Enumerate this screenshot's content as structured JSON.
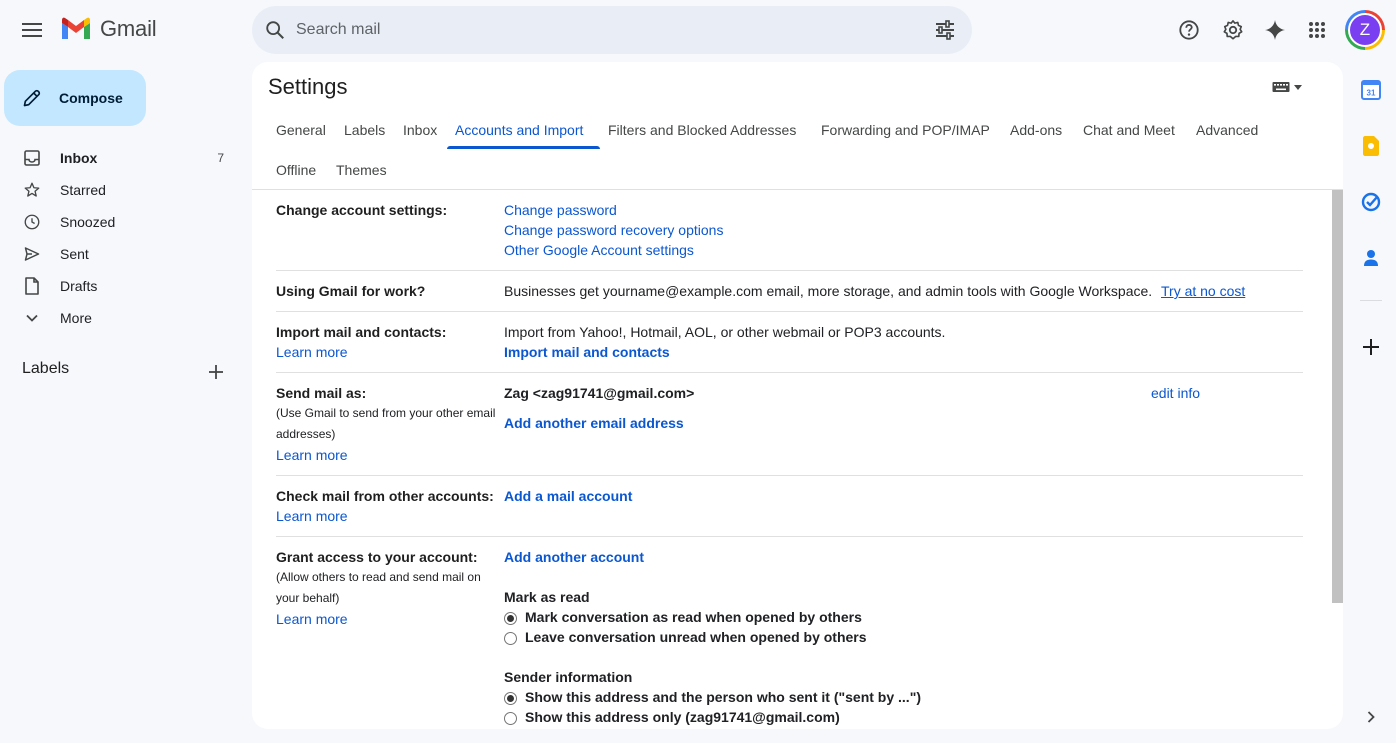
{
  "app": {
    "name": "Gmail"
  },
  "search": {
    "placeholder": "Search mail"
  },
  "user": {
    "initial": "Z"
  },
  "compose": {
    "label": "Compose"
  },
  "nav": {
    "items": [
      {
        "label": "Inbox",
        "count": "7",
        "icon": "inbox-icon"
      },
      {
        "label": "Starred",
        "count": "",
        "icon": "star-icon"
      },
      {
        "label": "Snoozed",
        "count": "",
        "icon": "clock-icon"
      },
      {
        "label": "Sent",
        "count": "",
        "icon": "send-icon"
      },
      {
        "label": "Drafts",
        "count": "",
        "icon": "draft-icon"
      },
      {
        "label": "More",
        "count": "",
        "icon": "chevron-down-icon"
      }
    ],
    "labels_heading": "Labels"
  },
  "settings": {
    "title": "Settings",
    "tabs": [
      "General",
      "Labels",
      "Inbox",
      "Accounts and Import",
      "Filters and Blocked Addresses",
      "Forwarding and POP/IMAP",
      "Add-ons",
      "Chat and Meet",
      "Advanced",
      "Offline",
      "Themes"
    ],
    "active_tab": "Accounts and Import",
    "change_account": {
      "label": "Change account settings:",
      "links": [
        "Change password",
        "Change password recovery options",
        "Other Google Account settings"
      ]
    },
    "gmail_work": {
      "label": "Using Gmail for work?",
      "text": "Businesses get yourname@example.com email, more storage, and admin tools with Google Workspace.",
      "link": "Try at no cost"
    },
    "import_mail": {
      "label": "Import mail and contacts:",
      "learn_more": "Learn more",
      "text": "Import from Yahoo!, Hotmail, AOL, or other webmail or POP3 accounts.",
      "action": "Import mail and contacts"
    },
    "send_mail_as": {
      "label": "Send mail as:",
      "note": "(Use Gmail to send from your other email addresses)",
      "learn_more": "Learn more",
      "address": "Zag <zag91741@gmail.com>",
      "edit": "edit info",
      "add": "Add another email address"
    },
    "check_mail": {
      "label": "Check mail from other accounts:",
      "learn_more": "Learn more",
      "action": "Add a mail account"
    },
    "grant_access": {
      "label": "Grant access to your account:",
      "note": "(Allow others to read and send mail on your behalf)",
      "learn_more": "Learn more",
      "action": "Add another account",
      "mark_as_read": {
        "heading": "Mark as read",
        "options": [
          "Mark conversation as read when opened by others",
          "Leave conversation unread when opened by others"
        ],
        "selected": 0
      },
      "sender_info": {
        "heading": "Sender information",
        "options": [
          "Show this address and the person who sent it (\"sent by ...\")",
          "Show this address only (zag91741@gmail.com)"
        ],
        "selected": 0
      }
    }
  },
  "colors": {
    "accent": "#0b57d0",
    "compose_bg": "#c2e7ff",
    "page_bg": "#f6f8fc"
  }
}
